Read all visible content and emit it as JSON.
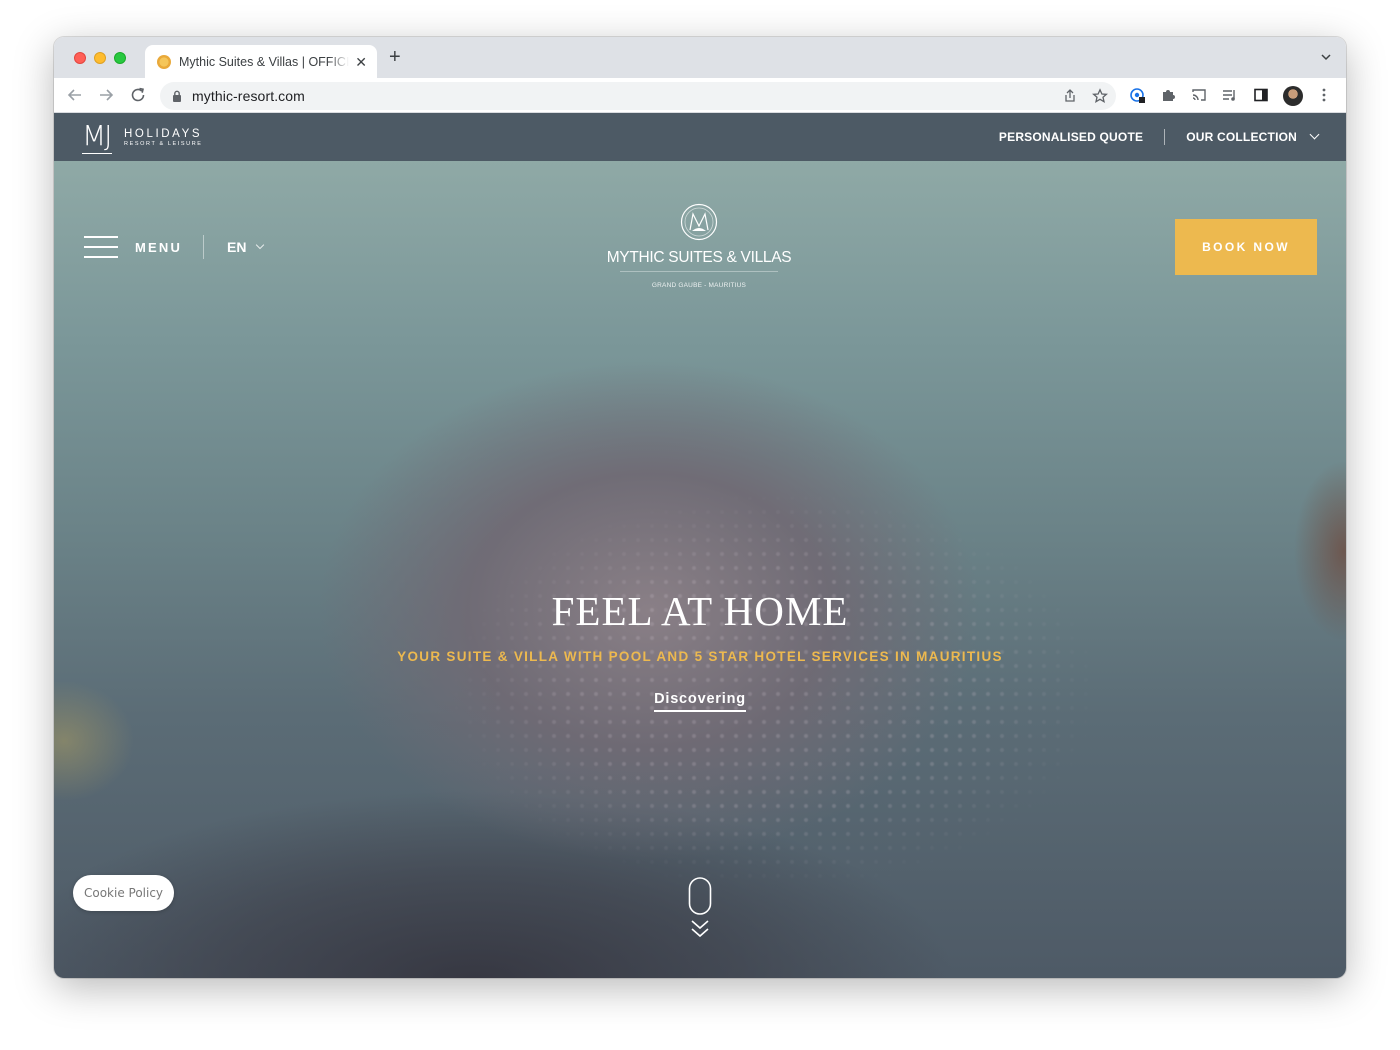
{
  "browser": {
    "tab_title": "Mythic Suites & Villas | OFFICIAL",
    "tab_close": "✕",
    "new_tab": "+",
    "url": "mythic-resort.com"
  },
  "site": {
    "brand_mark": "MJ",
    "brand_word": "HOLIDAYS",
    "brand_sub": "RESORT & LEISURE",
    "top_nav": {
      "quote": "PERSONALISED QUOTE",
      "collection": "OUR COLLECTION"
    },
    "menu_label": "MENU",
    "language": "EN",
    "hotel_name": "MYTHIC SUITES & VILLAS",
    "hotel_location": "GRAND GAUBE - MAURITIUS",
    "book_label": "BOOK NOW",
    "headline": "FEEL AT HOME",
    "tagline": "YOUR SUITE & VILLA WITH POOL AND 5 STAR HOTEL SERVICES IN MAURITIUS",
    "discover_label": "Discovering",
    "cookie_label": "Cookie Policy"
  },
  "colors": {
    "topbar": "#4d5a65",
    "accent_gold": "#edb94f",
    "chrome_bg": "#dee1e6"
  },
  "icons": [
    "back-icon",
    "forward-icon",
    "reload-icon",
    "lock-icon",
    "share-icon",
    "bookmark-star-icon",
    "extension-icon",
    "puzzle-icon",
    "cast-icon",
    "media-icon",
    "sidepanel-icon",
    "kebab-menu-icon",
    "hamburger-icon",
    "chevron-down-icon",
    "scroll-mouse-icon"
  ]
}
